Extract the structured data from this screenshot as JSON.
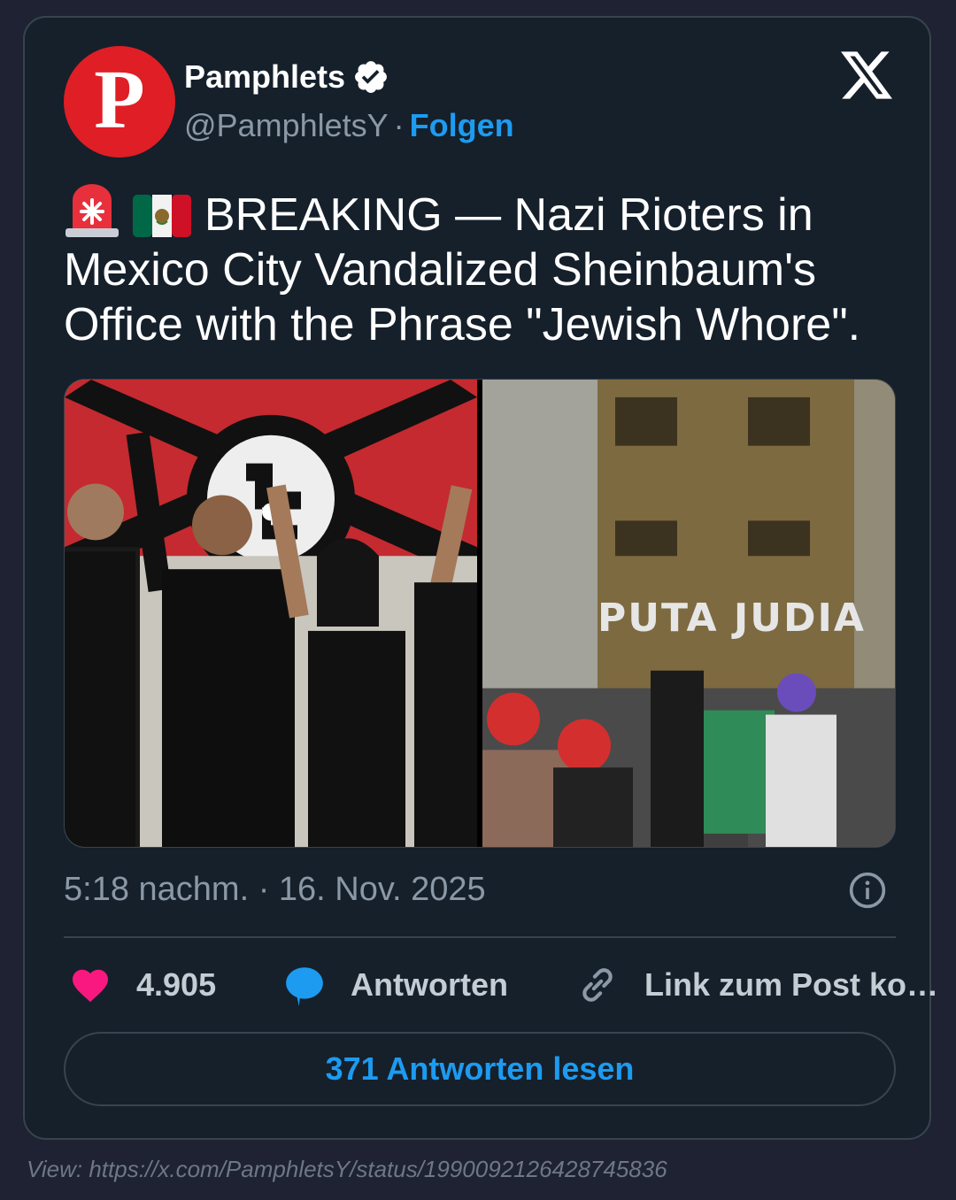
{
  "author": {
    "avatar_letter": "P",
    "name": "Pamphlets",
    "handle": "@PamphletsY",
    "separator": "·",
    "follow_label": "Folgen"
  },
  "platform_icon": "x-logo-icon",
  "tweet": {
    "emojis": [
      "police-light-emoji",
      "mexico-flag-emoji"
    ],
    "text": "BREAKING — Nazi Rioters in Mexico City Vandalized Sheinbaum's Office with the Phrase \"Jewish Whore\"."
  },
  "media": {
    "images": [
      {
        "description_icon": "photo-nazi-salute-group"
      },
      {
        "description_icon": "photo-vandalized-door"
      }
    ]
  },
  "timestamp": "5:18 nachm. · 16. Nov. 2025",
  "actions": {
    "likes": "4.905",
    "reply_label": "Antworten",
    "copy_link_label": "Link zum Post ko…"
  },
  "read_replies_label": "371 Antworten lesen",
  "footer": "View: https://x.com/PamphletsY/status/1990092126428745836",
  "colors": {
    "accent": "#1d9bf0",
    "heart": "#f91880",
    "card_bg": "#15202b",
    "page_bg": "#1e2233",
    "brand_red": "#e01e25"
  }
}
